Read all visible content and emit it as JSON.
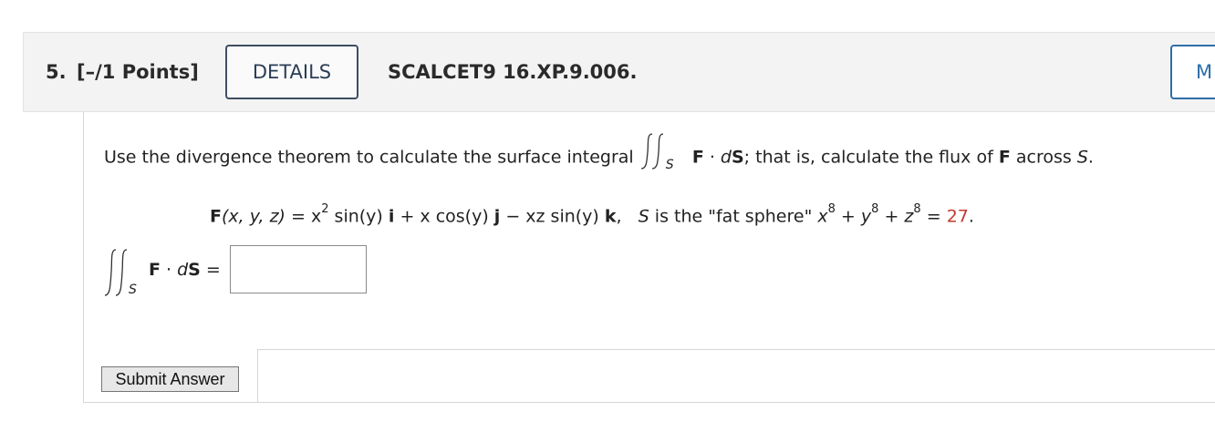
{
  "question": {
    "number": "5.",
    "points": "[–/1 Points]",
    "details_label": "DETAILS",
    "code": "SCALCET9 16.XP.9.006.",
    "more_label": "M"
  },
  "prompt": {
    "text_before": "Use the divergence theorem to calculate the surface integral",
    "integral_sub": "S",
    "F": "F",
    "dot": " · ",
    "dS_d": "d",
    "dS_S": "S",
    "text_after1": "; that is, calculate the flux of ",
    "F2": "F",
    "text_after2": " across ",
    "S_var": "S",
    "period": "."
  },
  "equation": {
    "lhs": "F",
    "args": "(x, y, z)",
    "rhs_part1": " = x",
    "exp2": "2",
    "rhs_part2": " sin(y)",
    "i": "i",
    "rhs_part3": " + x cos(y)",
    "j": "j",
    "rhs_part4": " − xz sin(y)",
    "k": "k",
    "comma": ",",
    "S_var": "S",
    "sphere_text": " is the \"fat sphere\" ",
    "x": "x",
    "exp8a": "8",
    "plus1": " + ",
    "y": "y",
    "exp8b": "8",
    "plus2": " + ",
    "z": "z",
    "exp8c": "8",
    "equals": " = ",
    "value": "27",
    "period": "."
  },
  "answer": {
    "integral_sub": "S",
    "F": "F",
    "dot": " · ",
    "d": "d",
    "S": "S",
    "equals": " =",
    "input_value": ""
  },
  "submit_label": "Submit Answer",
  "colors": {
    "accent_blue": "#2d6ea8",
    "details_border": "#3d4e63",
    "answer_red": "#c0392b"
  }
}
